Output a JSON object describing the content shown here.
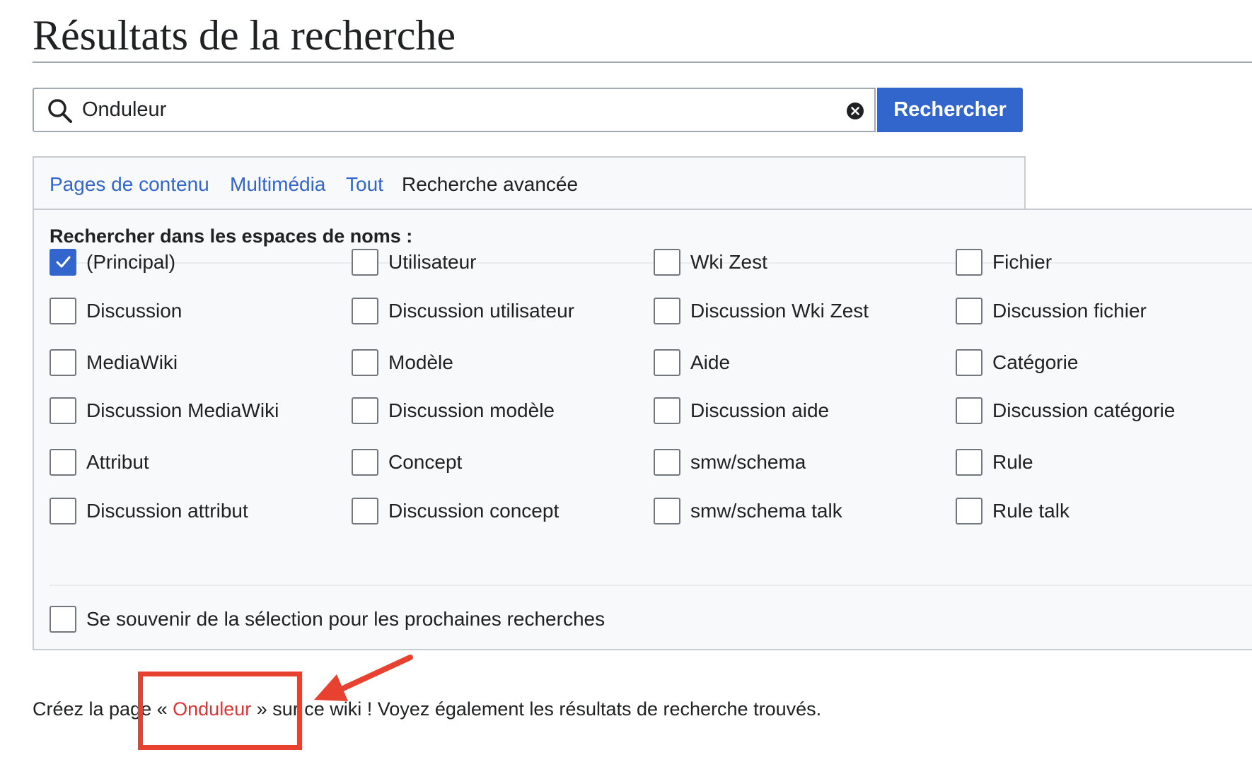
{
  "page": {
    "title": "Résultats de la recherche"
  },
  "search": {
    "value": "Onduleur",
    "button_label": "Rechercher"
  },
  "tabs": [
    {
      "label": "Pages de contenu"
    },
    {
      "label": "Multimédia"
    },
    {
      "label": "Tout"
    },
    {
      "label": "Recherche avancée"
    }
  ],
  "namespaces": {
    "heading": "Rechercher dans les espaces de noms :",
    "items": [
      {
        "label": "(Principal)",
        "checked": true
      },
      {
        "label": "Utilisateur",
        "checked": false
      },
      {
        "label": "Wki Zest",
        "checked": false
      },
      {
        "label": "Fichier",
        "checked": false
      },
      {
        "label": "Discussion",
        "checked": false
      },
      {
        "label": "Discussion utilisateur",
        "checked": false
      },
      {
        "label": "Discussion Wki Zest",
        "checked": false
      },
      {
        "label": "Discussion fichier",
        "checked": false
      },
      {
        "label": "MediaWiki",
        "checked": false
      },
      {
        "label": "Modèle",
        "checked": false
      },
      {
        "label": "Aide",
        "checked": false
      },
      {
        "label": "Catégorie",
        "checked": false
      },
      {
        "label": "Discussion MediaWiki",
        "checked": false
      },
      {
        "label": "Discussion modèle",
        "checked": false
      },
      {
        "label": "Discussion aide",
        "checked": false
      },
      {
        "label": "Discussion catégorie",
        "checked": false
      },
      {
        "label": "Attribut",
        "checked": false
      },
      {
        "label": "Concept",
        "checked": false
      },
      {
        "label": "smw/schema",
        "checked": false
      },
      {
        "label": "Rule",
        "checked": false
      },
      {
        "label": "Discussion attribut",
        "checked": false
      },
      {
        "label": "Discussion concept",
        "checked": false
      },
      {
        "label": "smw/schema talk",
        "checked": false
      },
      {
        "label": "Rule talk",
        "checked": false
      }
    ],
    "remember": {
      "label": "Se souvenir de la sélection pour les prochaines recherches",
      "checked": false
    }
  },
  "footer": {
    "prefix": "Créez la page «",
    "link": "Onduleur",
    "suffix": "» sur ce wiki ! Voyez également les résultats de recherche trouvés."
  },
  "colors": {
    "accent": "#3366cc",
    "redlink": "#dd3333",
    "annotation": "#e8412f"
  }
}
